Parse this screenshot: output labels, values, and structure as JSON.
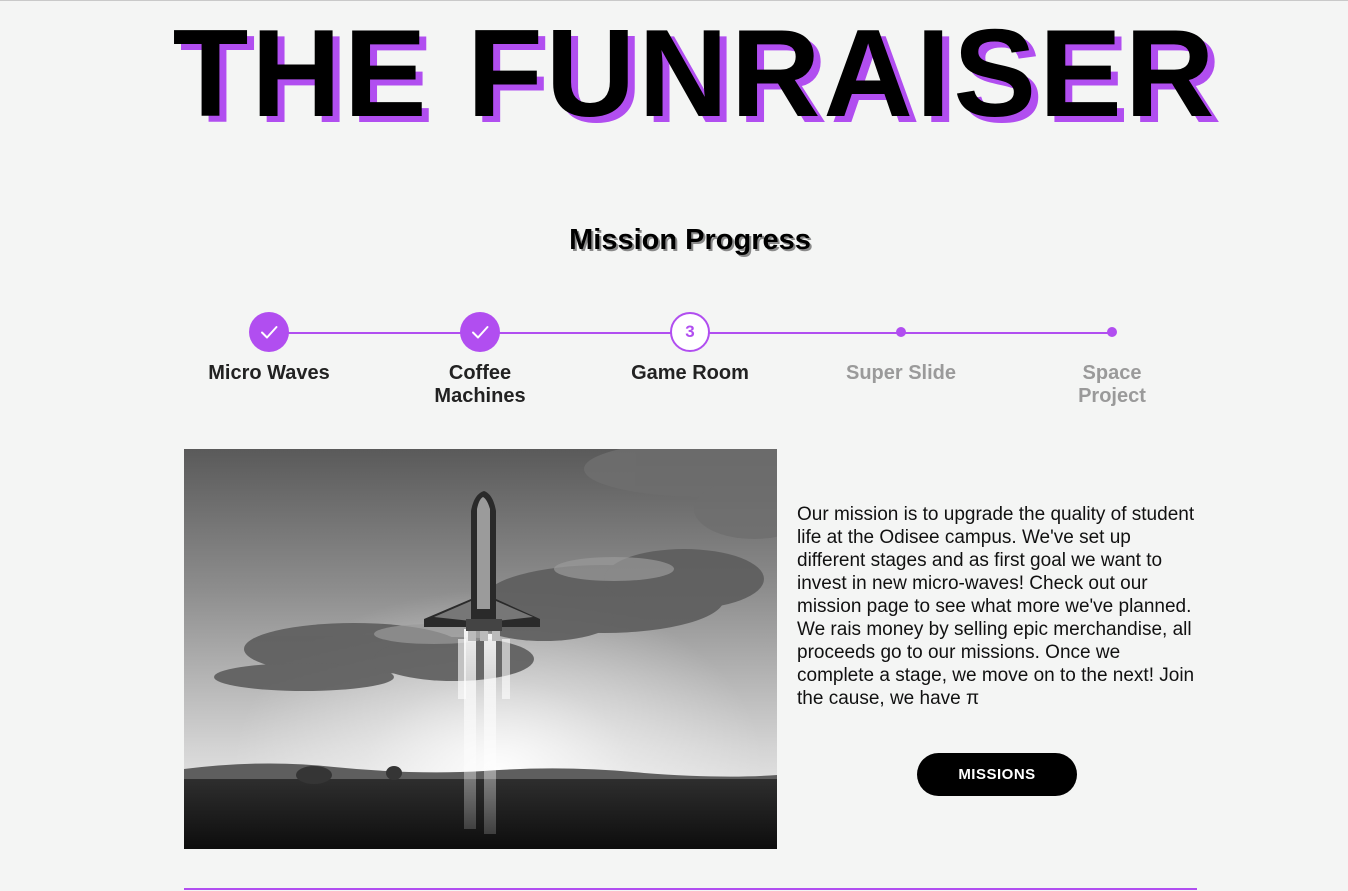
{
  "header": {
    "title": "THE FUNRAISER"
  },
  "progress": {
    "title": "Mission Progress",
    "current_step_number": "3",
    "steps": [
      {
        "label": "Micro Waves",
        "status": "completed"
      },
      {
        "label": "Coffee Machines",
        "status": "completed"
      },
      {
        "label": "Game Room",
        "status": "current"
      },
      {
        "label": "Super Slide",
        "status": "upcoming"
      },
      {
        "label": "Space Project",
        "status": "upcoming"
      }
    ]
  },
  "about": {
    "text": "Our mission is to upgrade the quality of student life at the Odisee campus. We've set up different stages and as first goal we want to invest in new micro-waves! Check out our mission page to see what more we've planned. We rais money by selling epic merchandise, all proceeds go to our missions. Once we complete a stage, we move on to the next! Join the cause, we have π",
    "button_label": "MISSIONS"
  },
  "colors": {
    "accent": "#b14ef0",
    "background": "#f4f5f4",
    "text": "#111111",
    "muted": "#9a9a9a",
    "button_bg": "#000000"
  }
}
